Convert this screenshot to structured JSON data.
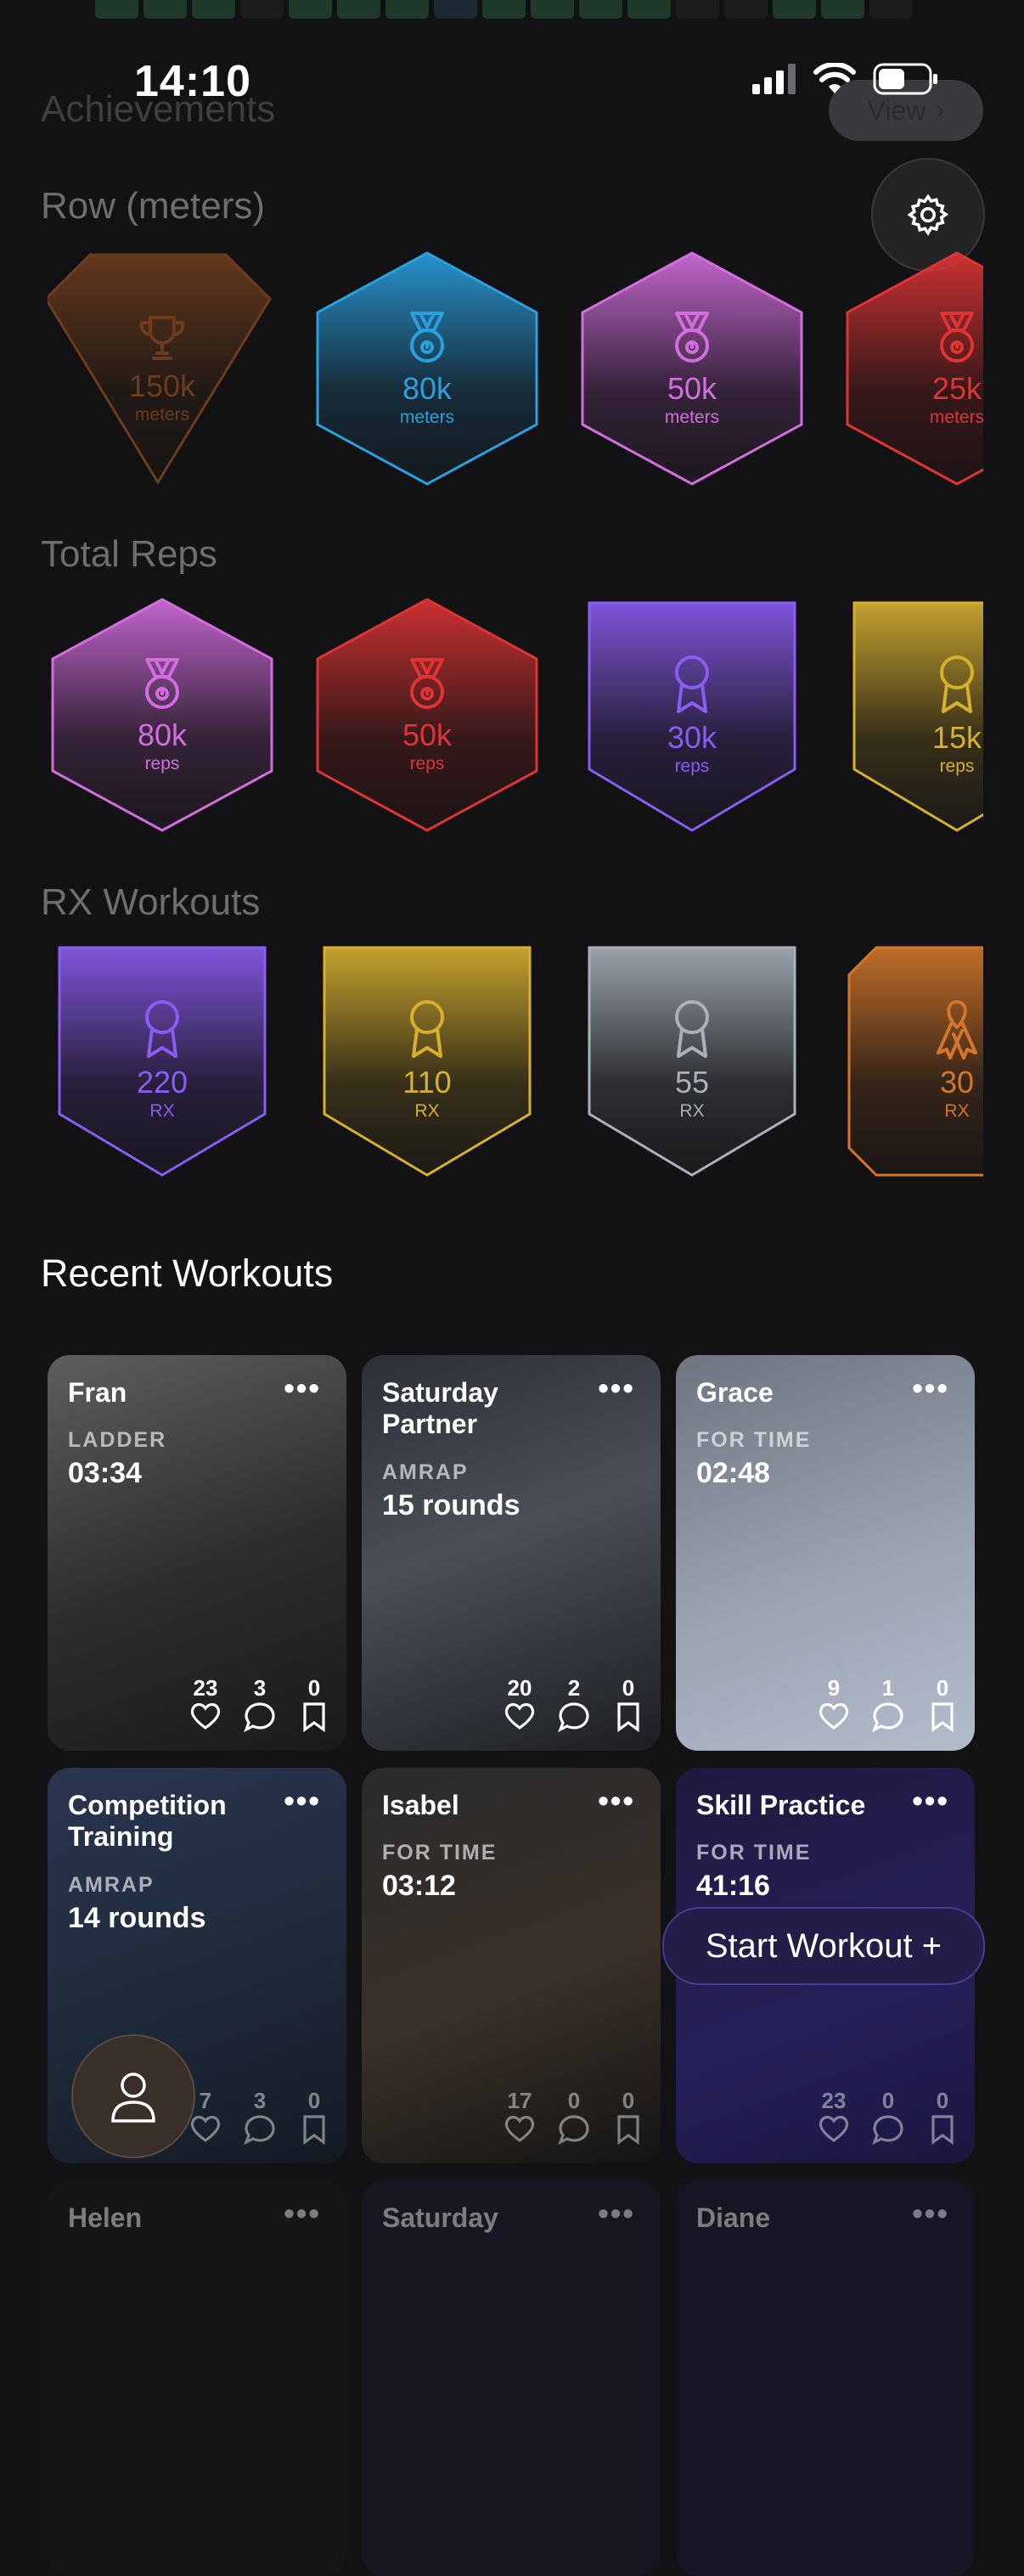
{
  "status_bar": {
    "time": "14:10"
  },
  "header": {
    "title": "Achievements",
    "view_label": "View"
  },
  "sections": {
    "row": {
      "title": "Row (meters)"
    },
    "reps": {
      "title": "Total Reps"
    },
    "rx": {
      "title": "RX Workouts"
    }
  },
  "row_badges": [
    {
      "value": "150k",
      "unit": "meters",
      "color": "#e8762a",
      "icon": "trophy-icon"
    },
    {
      "value": "80k",
      "unit": "meters",
      "color": "#2aa0e0",
      "icon": "medal-icon"
    },
    {
      "value": "50k",
      "unit": "meters",
      "color": "#d46ee0",
      "icon": "medal-icon"
    },
    {
      "value": "25k",
      "unit": "meters",
      "color": "#e03434",
      "icon": "medal-icon"
    }
  ],
  "reps_badges": [
    {
      "value": "80k",
      "unit": "reps",
      "color": "#d46ee0",
      "icon": "medal-icon"
    },
    {
      "value": "50k",
      "unit": "reps",
      "color": "#e03434",
      "icon": "medal-icon"
    },
    {
      "value": "30k",
      "unit": "reps",
      "color": "#8a5cf0",
      "icon": "ribbon-icon"
    },
    {
      "value": "15k",
      "unit": "reps",
      "color": "#d8b030",
      "icon": "ribbon-icon"
    }
  ],
  "rx_badges": [
    {
      "value": "220",
      "unit": "RX",
      "color": "#8a5cf0",
      "icon": "ribbon-icon"
    },
    {
      "value": "110",
      "unit": "RX",
      "color": "#d8b030",
      "icon": "ribbon-icon"
    },
    {
      "value": "55",
      "unit": "RX",
      "color": "#a9b1bb",
      "icon": "ribbon-icon"
    },
    {
      "value": "30",
      "unit": "RX",
      "color": "#d4762a",
      "icon": "awareness-ribbon-icon"
    }
  ],
  "recent": {
    "title": "Recent Workouts",
    "cards": [
      {
        "title": "Fran",
        "type": "LADDER",
        "score": "03:34",
        "likes": "23",
        "comments": "3",
        "saves": "0"
      },
      {
        "title": "Saturday Partner",
        "type": "AMRAP",
        "score": "15 rounds",
        "likes": "20",
        "comments": "2",
        "saves": "0"
      },
      {
        "title": "Grace",
        "type": "FOR TIME",
        "score": "02:48",
        "likes": "9",
        "comments": "1",
        "saves": "0"
      },
      {
        "title": "Competition Training",
        "type": "AMRAP",
        "score": "14 rounds",
        "likes": "7",
        "comments": "3",
        "saves": "0"
      },
      {
        "title": "Isabel",
        "type": "FOR TIME",
        "score": "03:12",
        "likes": "17",
        "comments": "0",
        "saves": "0"
      },
      {
        "title": "Skill Practice",
        "type": "FOR TIME",
        "score": "41:16",
        "likes": "23",
        "comments": "0",
        "saves": "0"
      },
      {
        "title": "Helen"
      },
      {
        "title": "Saturday"
      },
      {
        "title": "Diane"
      }
    ]
  },
  "start_workout_label": "Start Workout +"
}
